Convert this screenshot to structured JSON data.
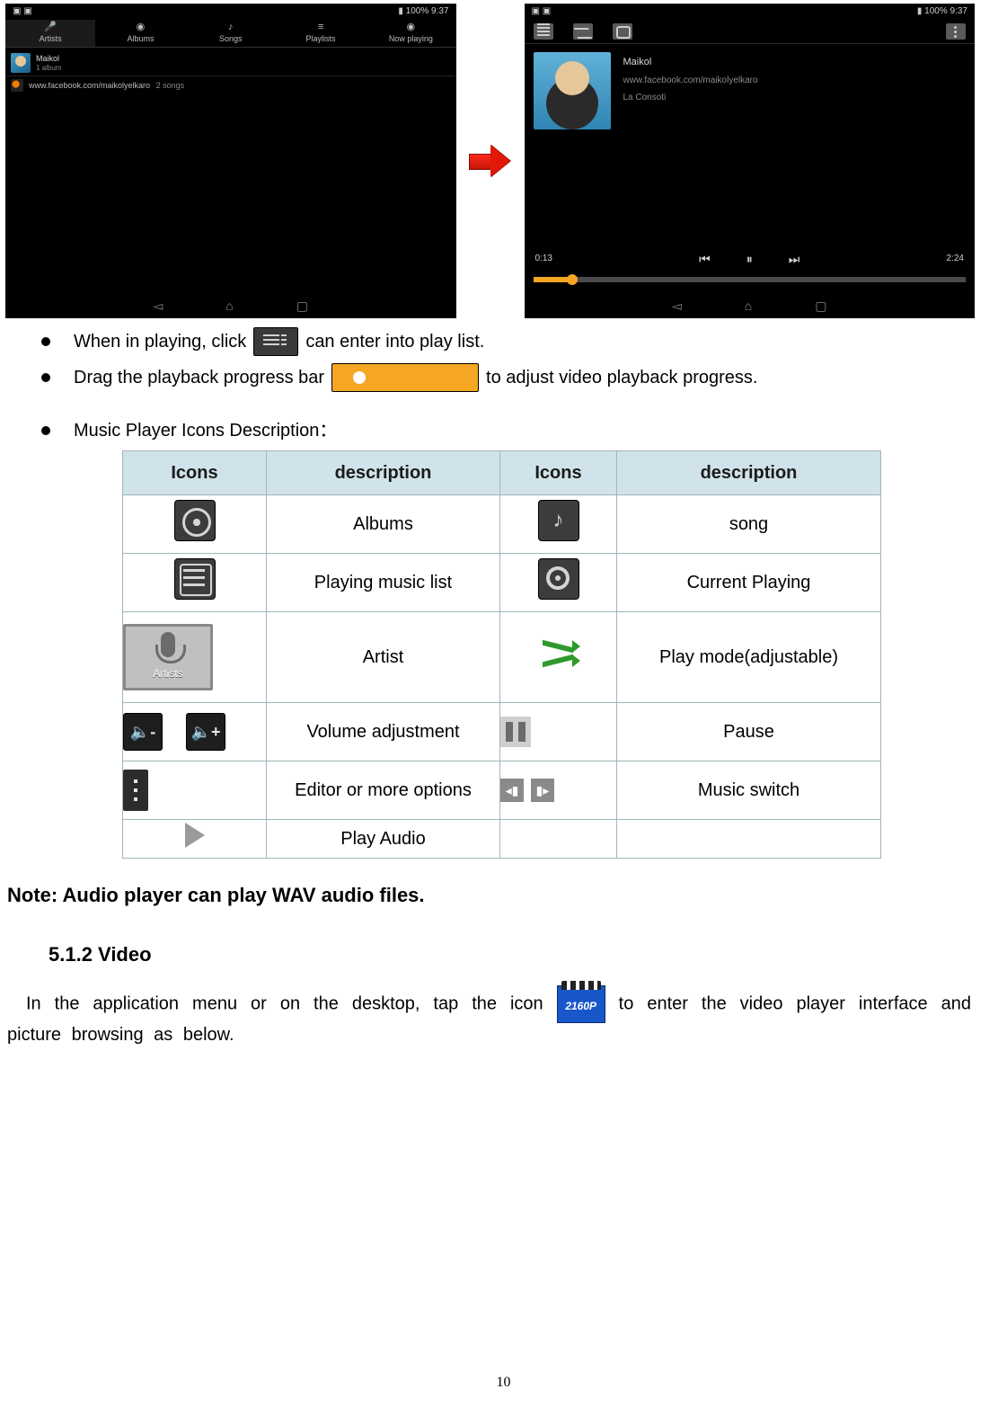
{
  "status_time": "9:37",
  "status_batt": "100%",
  "shot1": {
    "tabs": [
      "Artists",
      "Albums",
      "Songs",
      "Playlists",
      "Now playing"
    ],
    "artist_name": "Maikol",
    "artist_sub": "1 album",
    "song_title": "www.facebook.com/maikolyelkaro",
    "song_sub": "2 songs"
  },
  "shot2": {
    "track_artist": "Maikol",
    "track_site": "www.facebook.com/maikolyelkaro",
    "track_title": "La Consoti",
    "time_cur": "0:13",
    "time_tot": "2:24"
  },
  "bullets": {
    "b1_a": "When in playing, click",
    "b1_b": "can enter into play list.",
    "b2_a": "Drag the playback progress bar",
    "b2_b": "to adjust video playback progress.",
    "b3": "Music Player Icons Description："
  },
  "table": {
    "h_icons": "Icons",
    "h_desc": "description",
    "rows": [
      {
        "d1": "Albums",
        "d2": "song"
      },
      {
        "d1": "Playing music list",
        "d2": "Current Playing"
      },
      {
        "d1": "Artist",
        "art_label": "Artists",
        "d2": "Play mode(adjustable)"
      },
      {
        "d1": "Volume adjustment",
        "vminus": "🔉−",
        "vplus": "🔉+",
        "d2": "Pause"
      },
      {
        "d1": "Editor or more options",
        "d2": "Music switch"
      },
      {
        "d1": "Play Audio",
        "d2": ""
      }
    ]
  },
  "note": "Note: Audio player can play WAV audio files.",
  "sub_heading": "5.1.2 Video",
  "video_para_a": "In the application menu or on the desktop, tap the icon",
  "video_icon_label": "2160P",
  "video_para_b": "to enter the video player interface and picture browsing as below.",
  "page_number": "10"
}
